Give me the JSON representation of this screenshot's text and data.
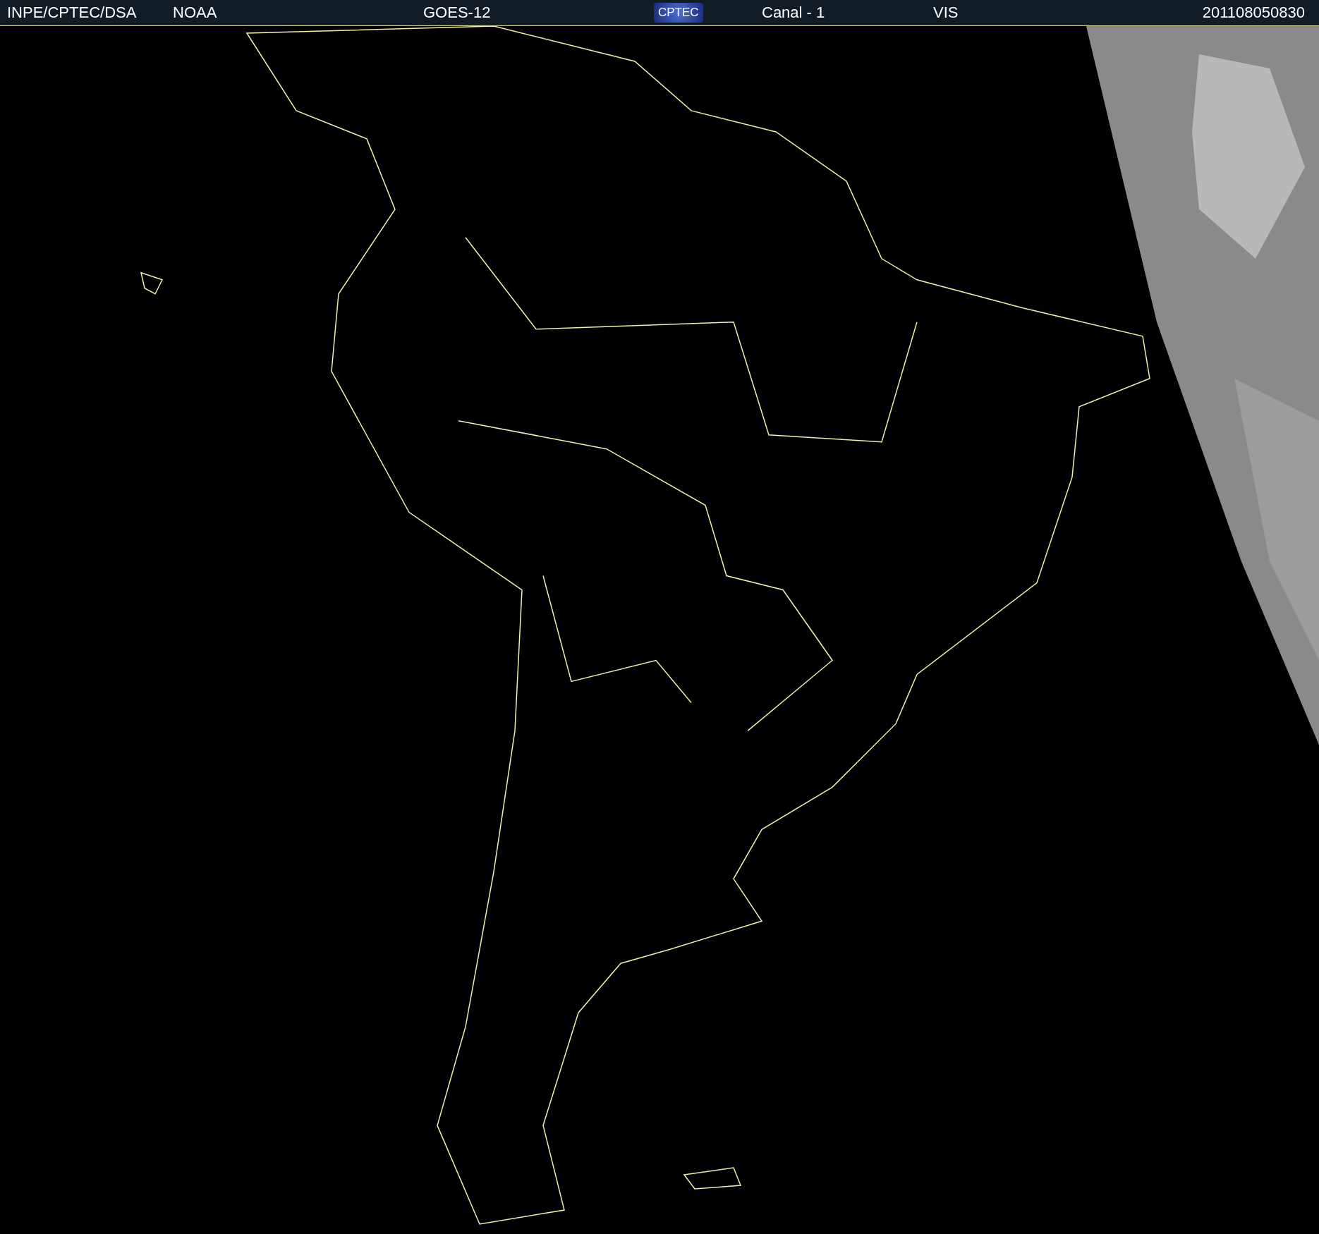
{
  "header": {
    "agency": "INPE/CPTEC/DSA",
    "source": "NOAA",
    "satellite": "GOES-12",
    "logo": "CPTEC",
    "channel": "Canal - 1",
    "band": "VIS",
    "timestamp": "201108050830"
  }
}
